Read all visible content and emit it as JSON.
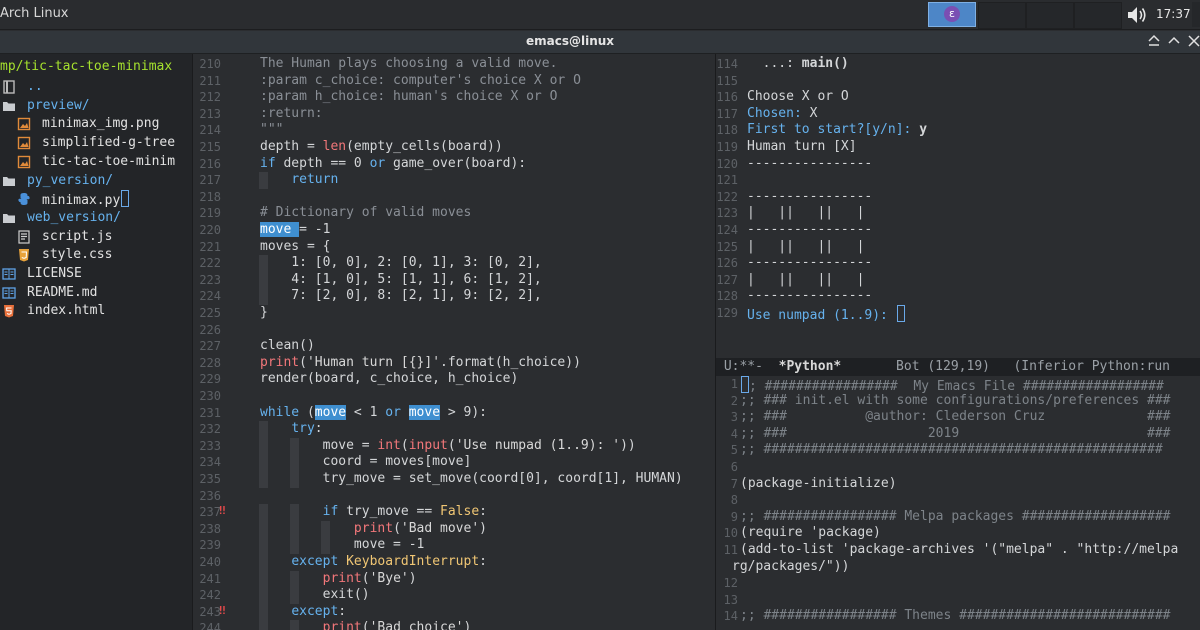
{
  "topbar": {
    "title": "Arch Linux",
    "clock": "17:37",
    "emacs_icon": "emacs-icon",
    "volume_icon": "volume-icon"
  },
  "window": {
    "title": "emacs@linux",
    "buttons": [
      "⌅",
      "⌃",
      "✕"
    ]
  },
  "tree": {
    "root": "mp/tic-tac-toe-minimax",
    "items": [
      {
        "label": "..",
        "type": "up",
        "indent": 0
      },
      {
        "label": "preview/",
        "type": "dir",
        "indent": 0
      },
      {
        "label": "minimax_img.png",
        "type": "image",
        "indent": 1
      },
      {
        "label": "simplified-g-tree",
        "type": "image",
        "indent": 1
      },
      {
        "label": "tic-tac-toe-minim",
        "type": "image",
        "indent": 1
      },
      {
        "label": "py_version/",
        "type": "dir",
        "indent": 0
      },
      {
        "label": "minimax.py",
        "type": "python",
        "indent": 1
      },
      {
        "label": "web_version/",
        "type": "dir",
        "indent": 0
      },
      {
        "label": "script.js",
        "type": "js",
        "indent": 1
      },
      {
        "label": "style.css",
        "type": "css",
        "indent": 1
      },
      {
        "label": "LICENSE",
        "type": "book",
        "indent": 0
      },
      {
        "label": "README.md",
        "type": "book",
        "indent": 0
      },
      {
        "label": "index.html",
        "type": "html",
        "indent": 0
      }
    ]
  },
  "code": {
    "line_numbers": [
      "210",
      "211",
      "212",
      "213",
      "214",
      "215",
      "216",
      "217",
      "218",
      "219",
      "220",
      "221",
      "222",
      "223",
      "224",
      "225",
      "226",
      "227",
      "228",
      "229",
      "230",
      "231",
      "232",
      "233",
      "234",
      "235",
      "236",
      "237",
      "238",
      "239",
      "240",
      "241",
      "242",
      "243",
      "244"
    ],
    "lines": [
      "The Human plays choosing a valid move.",
      ":param c_choice: computer's choice X or O",
      ":param h_choice: human's choice X or O",
      ":return:",
      "\"\"\"",
      "depth = len(empty_cells(board))",
      "if depth == 0 or game_over(board):",
      "    return",
      "",
      "# Dictionary of valid moves",
      "move = -1",
      "moves = {",
      "    1: [0, 0], 2: [0, 1], 3: [0, 2],",
      "    4: [1, 0], 5: [1, 1], 6: [1, 2],",
      "    7: [2, 0], 8: [2, 1], 9: [2, 2],",
      "}",
      "",
      "clean()",
      "print('Human turn [{}]'.format(h_choice))",
      "render(board, c_choice, h_choice)",
      "",
      "while (move < 1 or move > 9):",
      "    try:",
      "        move = int(input('Use numpad (1..9): '))",
      "        coord = moves[move]",
      "        try_move = set_move(coord[0], coord[1], HUMAN)",
      "",
      "        if try_move == False:",
      "            print('Bad move')",
      "            move = -1",
      "    except KeyboardInterrupt:",
      "        print('Bye')",
      "        exit()",
      "    except:",
      "        print('Bad choice')"
    ],
    "warning_marks": [
      "237",
      "243"
    ]
  },
  "repl": {
    "line_numbers": [
      "114",
      "115",
      "116",
      "117",
      "118",
      "119",
      "120",
      "121",
      "122",
      "123",
      "124",
      "125",
      "126",
      "127",
      "128",
      "129"
    ],
    "lines": [
      "  ...: main()",
      "",
      "Choose X or O",
      "Chosen: X",
      "First to start?[y/n]: y",
      "Human turn [X]",
      "----------------",
      "",
      "----------------",
      "|   ||   ||   |",
      "----------------",
      "|   ||   ||   |",
      "----------------",
      "|   ||   ||   |",
      "----------------",
      "Use numpad (1..9): "
    ]
  },
  "modeline": {
    "state": "U:**-",
    "buffer": "*Python*",
    "position": "Bot (129,19)",
    "mode": "(Inferior Python:run"
  },
  "init_el": {
    "line_numbers": [
      "1",
      "2",
      "3",
      "4",
      "5",
      "6",
      "7",
      "8",
      "9",
      "10",
      "11",
      "",
      "12",
      "13",
      "14"
    ],
    "lines": [
      ";; #################  My Emacs File ##################",
      ";; ### init.el with some configurations/preferences ###",
      ";; ###          @author: Clederson Cruz             ###",
      ";; ###                  2019                        ###",
      ";; ###################################################",
      "",
      "(package-initialize)",
      "",
      ";; ################# Melpa packages ###################",
      "(require 'package)",
      "(add-to-list 'package-archives '(\"melpa\" . \"http://melpa",
      "rg/packages/\"))",
      "",
      "",
      ";; ################# Themes ###########################"
    ]
  }
}
